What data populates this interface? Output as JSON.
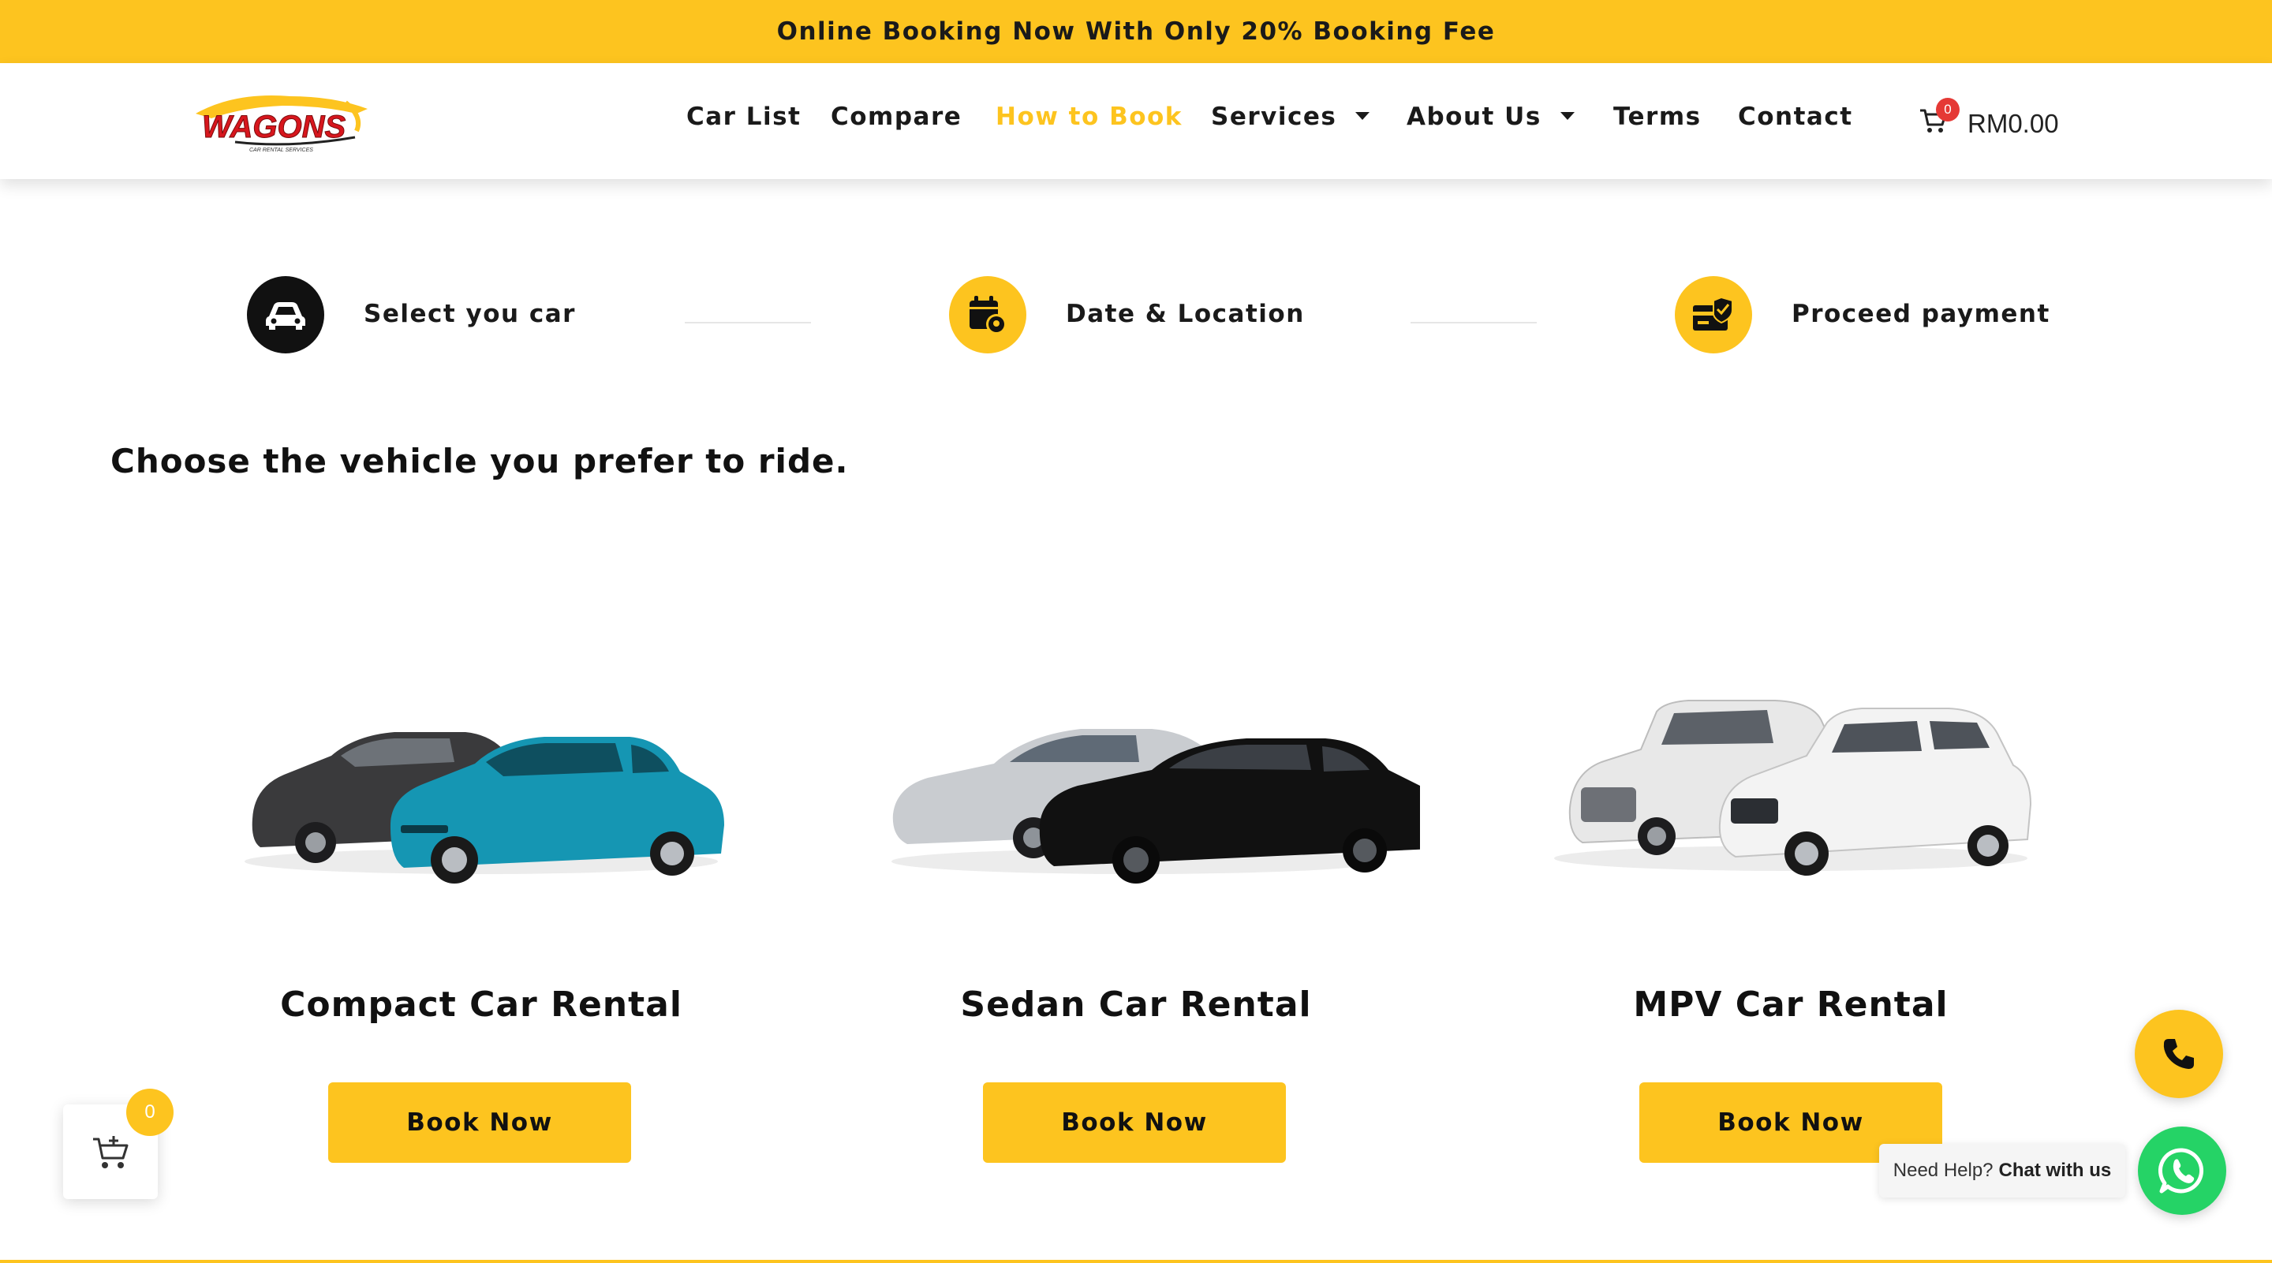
{
  "announcement": "Online Booking Now With Only 20% Booking Fee",
  "logo": {
    "text": "WAGONS",
    "tagline": "CAR RENTAL SERVICES",
    "icon": "car-logo"
  },
  "nav": {
    "items": [
      {
        "label": "Car List"
      },
      {
        "label": "Compare"
      },
      {
        "label": "How to Book",
        "active": true
      },
      {
        "label": "Services",
        "has_dropdown": true
      },
      {
        "label": "About Us",
        "has_dropdown": true
      },
      {
        "label": "Terms"
      },
      {
        "label": "Contact"
      }
    ],
    "cart": {
      "count": "0",
      "amount": "RM0.00",
      "icon": "cart-icon"
    }
  },
  "steps": [
    {
      "label": "Select you car",
      "icon": "car-icon",
      "style": "dark"
    },
    {
      "label": "Date & Location",
      "icon": "calendar-location-icon",
      "style": "yellow"
    },
    {
      "label": "Proceed payment",
      "icon": "card-check-icon",
      "style": "yellow"
    }
  ],
  "heading": "Choose the vehicle you prefer to ride.",
  "categories": [
    {
      "title": "Compact Car Rental",
      "button": "Book Now",
      "colors": [
        "#3a3a3c",
        "#1596b3"
      ]
    },
    {
      "title": "Sedan Car Rental",
      "button": "Book Now",
      "colors": [
        "#c9ccd0",
        "#111111"
      ]
    },
    {
      "title": "MPV Car Rental",
      "button": "Book Now",
      "colors": [
        "#e8e8e8",
        "#f3f3f3"
      ]
    }
  ],
  "floating_cart": {
    "count": "0",
    "icon": "add-to-cart-icon"
  },
  "phone": {
    "icon": "phone-icon"
  },
  "whatsapp": {
    "prompt": "Need Help?",
    "action": "Chat with us",
    "icon": "whatsapp-icon"
  },
  "colors": {
    "accent": "#FDC41F",
    "dark": "#111111",
    "whatsapp": "#25D366",
    "badge_red": "#e53935"
  }
}
